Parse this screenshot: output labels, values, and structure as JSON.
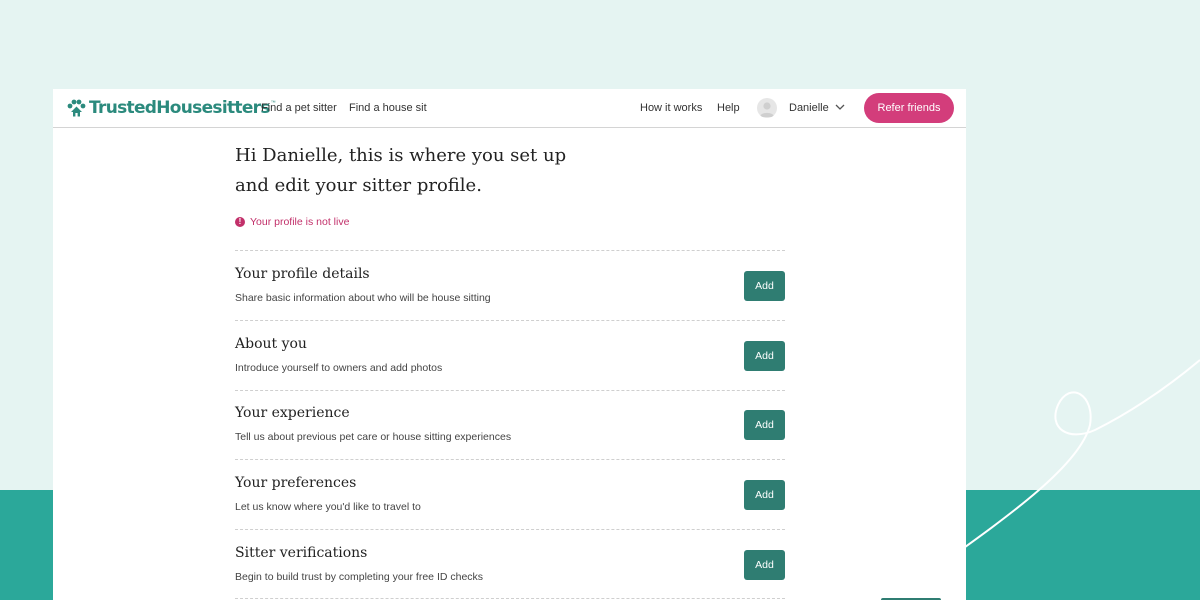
{
  "brand": {
    "name": "TrustedHousesitters",
    "trademark": "™",
    "color": "#2b8a7d"
  },
  "nav": {
    "find_pet_sitter": "Find a pet sitter",
    "find_house_sit": "Find a house sit",
    "how_it_works": "How it works",
    "help": "Help",
    "user_name": "Danielle",
    "refer_friends": "Refer friends"
  },
  "page": {
    "title_line1": "Hi Danielle, this is where you set up",
    "title_line2": "and edit your sitter profile.",
    "status_text": "Your profile is not live",
    "status_color": "#c2306a"
  },
  "sections": [
    {
      "title": "Your profile details",
      "description": "Share basic information about who will be house sitting",
      "button": "Add"
    },
    {
      "title": "About you",
      "description": "Introduce yourself to owners and add photos",
      "button": "Add"
    },
    {
      "title": "Your experience",
      "description": "Tell us about previous pet care or house sitting experiences",
      "button": "Add"
    },
    {
      "title": "Your preferences",
      "description": "Let us know where you'd like to travel to",
      "button": "Add"
    },
    {
      "title": "Sitter verifications",
      "description": "Begin to build trust by completing your free ID checks",
      "button": "Add"
    }
  ],
  "colors": {
    "accent_pink": "#d33d7b",
    "button_green": "#2f7d72",
    "background_light": "#e5f4f2",
    "background_teal": "#2ba89a"
  }
}
